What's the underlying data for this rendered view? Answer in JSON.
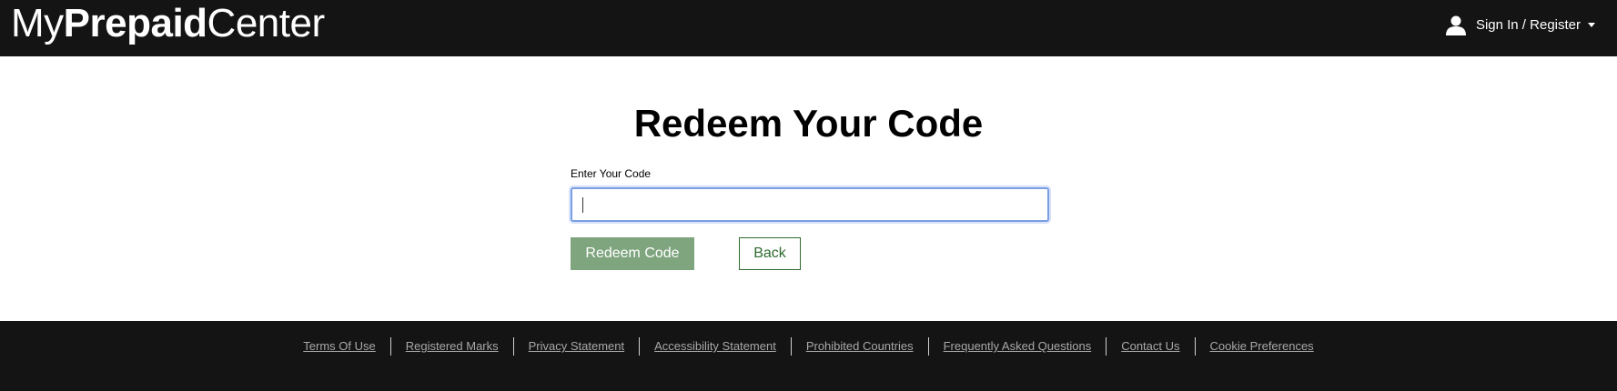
{
  "header": {
    "logo_part1": "My",
    "logo_part2": "Prepaid",
    "logo_part3": "Center",
    "signin_label": "Sign In / Register",
    "user_icon": "user-icon",
    "caret_icon": "caret-down-icon"
  },
  "main": {
    "title": "Redeem Your Code",
    "code_label": "Enter Your Code",
    "code_value": "",
    "redeem_label": "Redeem Code",
    "back_label": "Back"
  },
  "footer": {
    "links": [
      "Terms Of Use",
      "Registered Marks",
      "Privacy Statement",
      "Accessibility Statement",
      "Prohibited Countries",
      "Frequently Asked Questions",
      "Contact Us",
      "Cookie Preferences"
    ]
  },
  "colors": {
    "header_bg": "#141414",
    "redeem_button": "#7fa57f",
    "back_button_border": "#2f6b2f",
    "input_focus": "#7c9fe3"
  }
}
